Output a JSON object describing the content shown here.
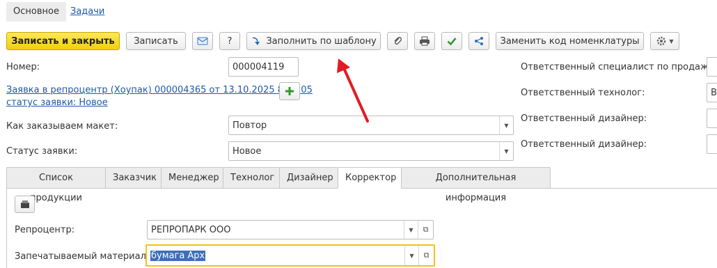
{
  "nav": {
    "tabs": [
      {
        "label": "Основное",
        "active": true
      },
      {
        "label": "Задачи",
        "active": false
      }
    ]
  },
  "toolbar": {
    "save_close_label": "Записать и закрыть",
    "save_label": "Записать",
    "help_label": "?",
    "fill_template_label": "Заполнить по шаблону",
    "replace_code_label": "Заменить код номенклатуры",
    "icons": [
      "envelope-icon",
      "arrow-icon",
      "paperclip-icon",
      "printer-icon",
      "checkmark-icon",
      "share-icon",
      "gear-icon"
    ],
    "accent_color": "#f5d423"
  },
  "form": {
    "number_label": "Номер:",
    "number_value": "000004119",
    "request_link": "Заявка в репроцентр (Хоупак) 000004365 от 13.10.2025 8:18:05",
    "request_status_link": "статус заявки: Новое",
    "layout_label": "Как заказываем макет:",
    "layout_value": "Повтор",
    "status_label": "Статус заявки:",
    "status_value": "Новое"
  },
  "right": {
    "sales_label": "Ответственный специалист по продажам:",
    "tech_label": "Ответственный технолог:",
    "tech_value": "Вь",
    "designer1_label": "Ответственный дизайнер:",
    "designer2_label": "Ответственный дизайнер:"
  },
  "section_tabs": [
    {
      "label": "Список продукции",
      "active": false
    },
    {
      "label": "Заказчик",
      "active": false
    },
    {
      "label": "Менеджер",
      "active": false
    },
    {
      "label": "Технолог",
      "active": false
    },
    {
      "label": "Дизайнер",
      "active": false
    },
    {
      "label": "Корректор",
      "active": true
    },
    {
      "label": "Дополнительная информация",
      "active": false
    }
  ],
  "corrector": {
    "reprocenter_label": "Репроцентр:",
    "reprocenter_value": "РЕПРОПАРК ООО",
    "material_label": "Запечатываемый материал:",
    "material_value": "бумага Арх"
  }
}
